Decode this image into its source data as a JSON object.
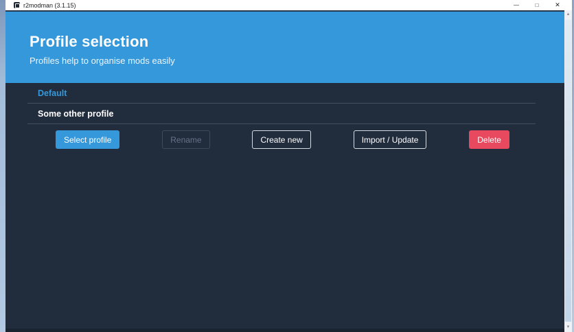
{
  "window": {
    "title": "r2modman (3.1.15)",
    "controls": {
      "minimize": "—",
      "maximize": "□",
      "close": "✕"
    }
  },
  "header": {
    "title": "Profile selection",
    "subtitle": "Profiles help to organise mods easily"
  },
  "profile_list": {
    "items": [
      {
        "name": "Default",
        "state": "selected"
      },
      {
        "name": "Some other profile",
        "state": "normal"
      }
    ]
  },
  "actions": {
    "select_profile": "Select profile",
    "rename": "Rename",
    "create_new": "Create new",
    "import_update": "Import / Update",
    "delete": "Delete"
  },
  "scrollbar": {
    "up_arrow": "▲",
    "down_arrow": "▼"
  },
  "colors": {
    "accent_blue": "#3498db",
    "danger_red": "#e8495f",
    "background_dark": "#212c3d",
    "titlebar_white": "#ffffff"
  }
}
